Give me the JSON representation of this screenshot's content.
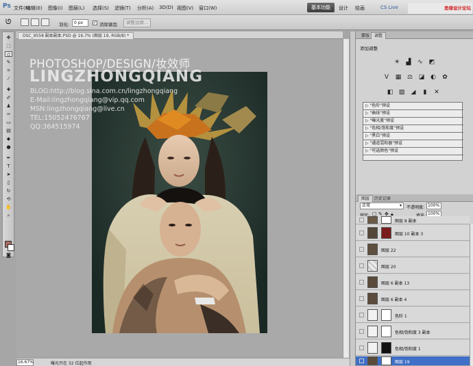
{
  "app": {
    "logo": "Ps",
    "workspace_active": "基本功能",
    "workspace_design": "设计",
    "workspace_paint": "绘画",
    "cslive": "CS Live"
  },
  "menu": [
    "文件(F)",
    "编辑(E)",
    "图像(I)",
    "图层(L)",
    "选择(S)",
    "滤镜(T)",
    "分析(A)",
    "3D(D)",
    "视图(V)",
    "窗口(W)"
  ],
  "mini_toolbar": {
    "zoom": "16.7"
  },
  "watermark_logo": "思缘设计论坛 WWW.MISSYUAN.COM",
  "options": {
    "feather_label": "羽化:",
    "feather_value": "0 px",
    "antialias_label": "消除锯齿",
    "antialias_mark": "✓",
    "refine_label": "调整边缘..."
  },
  "document": {
    "tab_title": "DSC_9558 副本副本.PSD @ 16.7% (图层 19, RGB/8) *"
  },
  "photo_watermark": {
    "title": "PHOTOSHOP/DESIGN/妆效师",
    "name": "LINGZHONGQIANG",
    "lines": [
      "BLOG:http://blog.sina.com.cn/lingzhongqiang",
      "E-Mail:lingzhongqiang@vip.qq.com",
      "MSN:lingzhongqiang@live.cn",
      "TEL:15052476767",
      "QQ:364515974"
    ]
  },
  "status": {
    "zoom": "16.67%",
    "text": "曝光只在 32 位起作用"
  },
  "panels": {
    "tabs_top": [
      "蒙版",
      "调整"
    ],
    "adjust_title": "添加调整",
    "presets": [
      "\"色阶\"预设",
      "\"曲线\"预设",
      "\"曝光度\"预设",
      "\"色相/饱和度\"预设",
      "\"黑白\"预设",
      "\"通道混和器\"预设",
      "\"可选颜色\"预设"
    ],
    "tabs_layers": [
      "图层",
      "历史记录"
    ],
    "blend_mode": "正常",
    "opacity_label": "不透明度:",
    "opacity": "100%",
    "lock_label": "锁定:",
    "fill_label": "填充:",
    "fill": "100%"
  },
  "layers": [
    {
      "name": "图层 8 副本"
    },
    {
      "name": "图层 10 副本 3"
    },
    {
      "name": "图层 22"
    },
    {
      "name": "图层 20"
    },
    {
      "name": "图层 6 副本 13"
    },
    {
      "name": "图层 6 副本 4"
    },
    {
      "name": "色阶 1"
    },
    {
      "name": "色相/饱和度 3 副本"
    },
    {
      "name": "色相/饱和度 1"
    },
    {
      "name": "图层 19"
    }
  ]
}
